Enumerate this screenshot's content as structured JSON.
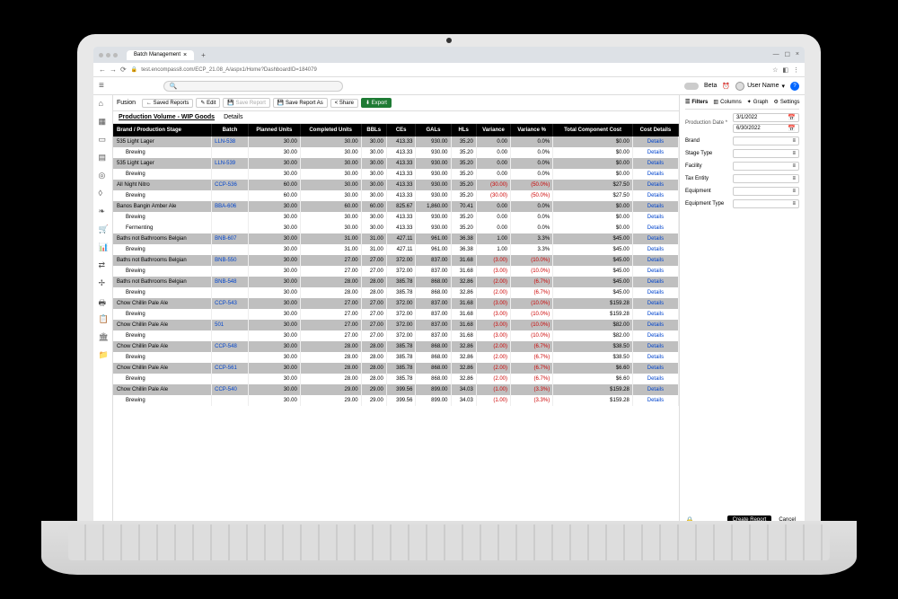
{
  "browser": {
    "tab_title": "Batch Management",
    "url": "test.encompass8.com/ECP_21.08_A/aspx1/Home?DashboardID=184079"
  },
  "header": {
    "beta": "Beta",
    "user": "User Name",
    "search_placeholder": ""
  },
  "toolbar": {
    "fusion": "Fusion",
    "saved_reports": "← Saved Reports",
    "edit": "✎ Edit",
    "save_report": "💾 Save Report",
    "save_as": "💾 Save Report As",
    "share": "< Share",
    "export": "⬇ Export"
  },
  "tabs": {
    "main": "Production Volume - WIP Goods",
    "details": "Details"
  },
  "columns": [
    "Brand / Production Stage",
    "Batch",
    "Planned Units",
    "Completed Units",
    "BBLs",
    "CEs",
    "GALs",
    "HLs",
    "Variance",
    "Variance %",
    "Total Component Cost",
    "Cost Details"
  ],
  "rows": [
    {
      "t": "g",
      "c": [
        "535 Light Lager",
        "LLN-538",
        "30.00",
        "30.00",
        "30.00",
        "413.33",
        "930.00",
        "35.20",
        "0.00",
        "0.0%",
        "$0.00",
        "Details"
      ]
    },
    {
      "t": "s",
      "c": [
        "Brewing",
        "",
        "30.00",
        "30.00",
        "30.00",
        "413.33",
        "930.00",
        "35.20",
        "0.00",
        "0.0%",
        "$0.00",
        "Details"
      ]
    },
    {
      "t": "g",
      "c": [
        "535 Light Lager",
        "LLN-539",
        "30.00",
        "30.00",
        "30.00",
        "413.33",
        "930.00",
        "35.20",
        "0.00",
        "0.0%",
        "$0.00",
        "Details"
      ]
    },
    {
      "t": "s",
      "c": [
        "Brewing",
        "",
        "30.00",
        "30.00",
        "30.00",
        "413.33",
        "930.00",
        "35.20",
        "0.00",
        "0.0%",
        "$0.00",
        "Details"
      ]
    },
    {
      "t": "g",
      "c": [
        "All Night Nitro",
        "CCP-536",
        "60.00",
        "30.00",
        "30.00",
        "413.33",
        "930.00",
        "35.20",
        "(30.00)",
        "(50.0%)",
        "$27.50",
        "Details"
      ],
      "neg": [
        8,
        9
      ]
    },
    {
      "t": "s",
      "c": [
        "Brewing",
        "",
        "60.00",
        "30.00",
        "30.00",
        "413.33",
        "930.00",
        "35.20",
        "(30.00)",
        "(50.0%)",
        "$27.50",
        "Details"
      ],
      "neg": [
        8,
        9
      ]
    },
    {
      "t": "g",
      "c": [
        "Banos Bangin Amber Ale",
        "BBA-606",
        "30.00",
        "60.00",
        "60.00",
        "825.67",
        "1,860.00",
        "70.41",
        "0.00",
        "0.0%",
        "$0.00",
        "Details"
      ]
    },
    {
      "t": "s",
      "c": [
        "Brewing",
        "",
        "30.00",
        "30.00",
        "30.00",
        "413.33",
        "930.00",
        "35.20",
        "0.00",
        "0.0%",
        "$0.00",
        "Details"
      ]
    },
    {
      "t": "s",
      "c": [
        "Fermenting",
        "",
        "30.00",
        "30.00",
        "30.00",
        "413.33",
        "930.00",
        "35.20",
        "0.00",
        "0.0%",
        "$0.00",
        "Details"
      ]
    },
    {
      "t": "g",
      "c": [
        "Baths not Bathrooms Belgian",
        "BNB-607",
        "30.00",
        "31.00",
        "31.00",
        "427.11",
        "961.00",
        "36.38",
        "1.00",
        "3.3%",
        "$45.00",
        "Details"
      ]
    },
    {
      "t": "s",
      "c": [
        "Brewing",
        "",
        "30.00",
        "31.00",
        "31.00",
        "427.11",
        "961.00",
        "36.38",
        "1.00",
        "3.3%",
        "$45.00",
        "Details"
      ]
    },
    {
      "t": "g",
      "c": [
        "Baths not Bathrooms Belgian",
        "BNB-550",
        "30.00",
        "27.00",
        "27.00",
        "372.00",
        "837.00",
        "31.68",
        "(3.00)",
        "(10.0%)",
        "$45.00",
        "Details"
      ],
      "neg": [
        8,
        9
      ]
    },
    {
      "t": "s",
      "c": [
        "Brewing",
        "",
        "30.00",
        "27.00",
        "27.00",
        "372.00",
        "837.00",
        "31.68",
        "(3.00)",
        "(10.0%)",
        "$45.00",
        "Details"
      ],
      "neg": [
        8,
        9
      ]
    },
    {
      "t": "g",
      "c": [
        "Baths not Bathrooms Belgian",
        "BNB-548",
        "30.00",
        "28.00",
        "28.00",
        "385.78",
        "868.00",
        "32.86",
        "(2.00)",
        "(6.7%)",
        "$45.00",
        "Details"
      ],
      "neg": [
        8,
        9
      ]
    },
    {
      "t": "s",
      "c": [
        "Brewing",
        "",
        "30.00",
        "28.00",
        "28.00",
        "385.78",
        "868.00",
        "32.86",
        "(2.00)",
        "(6.7%)",
        "$45.00",
        "Details"
      ],
      "neg": [
        8,
        9
      ]
    },
    {
      "t": "g",
      "c": [
        "Chow Chillin Pale Ale",
        "CCP-543",
        "30.00",
        "27.00",
        "27.00",
        "372.00",
        "837.00",
        "31.68",
        "(3.00)",
        "(10.0%)",
        "$159.28",
        "Details"
      ],
      "neg": [
        8,
        9
      ]
    },
    {
      "t": "s",
      "c": [
        "Brewing",
        "",
        "30.00",
        "27.00",
        "27.00",
        "372.00",
        "837.00",
        "31.68",
        "(3.00)",
        "(10.0%)",
        "$159.28",
        "Details"
      ],
      "neg": [
        8,
        9
      ]
    },
    {
      "t": "g",
      "c": [
        "Chow Chillin Pale Ale",
        "501",
        "30.00",
        "27.00",
        "27.00",
        "372.00",
        "837.00",
        "31.68",
        "(3.00)",
        "(10.0%)",
        "$82.00",
        "Details"
      ],
      "neg": [
        8,
        9
      ]
    },
    {
      "t": "s",
      "c": [
        "Brewing",
        "",
        "30.00",
        "27.00",
        "27.00",
        "372.00",
        "837.00",
        "31.68",
        "(3.00)",
        "(10.0%)",
        "$82.00",
        "Details"
      ],
      "neg": [
        8,
        9
      ]
    },
    {
      "t": "g",
      "c": [
        "Chow Chillin Pale Ale",
        "CCP-548",
        "30.00",
        "28.00",
        "28.00",
        "385.78",
        "868.00",
        "32.86",
        "(2.00)",
        "(6.7%)",
        "$38.50",
        "Details"
      ],
      "neg": [
        8,
        9
      ]
    },
    {
      "t": "s",
      "c": [
        "Brewing",
        "",
        "30.00",
        "28.00",
        "28.00",
        "385.78",
        "868.00",
        "32.86",
        "(2.00)",
        "(6.7%)",
        "$38.50",
        "Details"
      ],
      "neg": [
        8,
        9
      ]
    },
    {
      "t": "g",
      "c": [
        "Chow Chillin Pale Ale",
        "CCP-561",
        "30.00",
        "28.00",
        "28.00",
        "385.78",
        "868.00",
        "32.86",
        "(2.00)",
        "(6.7%)",
        "$6.60",
        "Details"
      ],
      "neg": [
        8,
        9
      ]
    },
    {
      "t": "s",
      "c": [
        "Brewing",
        "",
        "30.00",
        "28.00",
        "28.00",
        "385.78",
        "868.00",
        "32.86",
        "(2.00)",
        "(6.7%)",
        "$6.60",
        "Details"
      ],
      "neg": [
        8,
        9
      ]
    },
    {
      "t": "g",
      "c": [
        "Chow Chillin Pale Ale",
        "CCP-540",
        "30.00",
        "29.00",
        "29.00",
        "399.56",
        "899.00",
        "34.03",
        "(1.00)",
        "(3.3%)",
        "$159.28",
        "Details"
      ],
      "neg": [
        8,
        9
      ]
    },
    {
      "t": "s",
      "c": [
        "Brewing",
        "",
        "30.00",
        "29.00",
        "29.00",
        "399.56",
        "899.00",
        "34.03",
        "(1.00)",
        "(3.3%)",
        "$159.28",
        "Details"
      ],
      "neg": [
        8,
        9
      ]
    }
  ],
  "panel": {
    "tabs": {
      "filters": "Filters",
      "columns": "Columns",
      "graph": "Graph",
      "settings": "Settings"
    },
    "prod_date_label": "Production Date *",
    "date_from": "3/1/2022",
    "date_to": "6/30/2022",
    "filters": [
      "Brand",
      "Stage Type",
      "Facility",
      "Tax Entity",
      "Equipment",
      "Equipment Type"
    ],
    "create": "Create Report",
    "cancel": "Cancel"
  }
}
